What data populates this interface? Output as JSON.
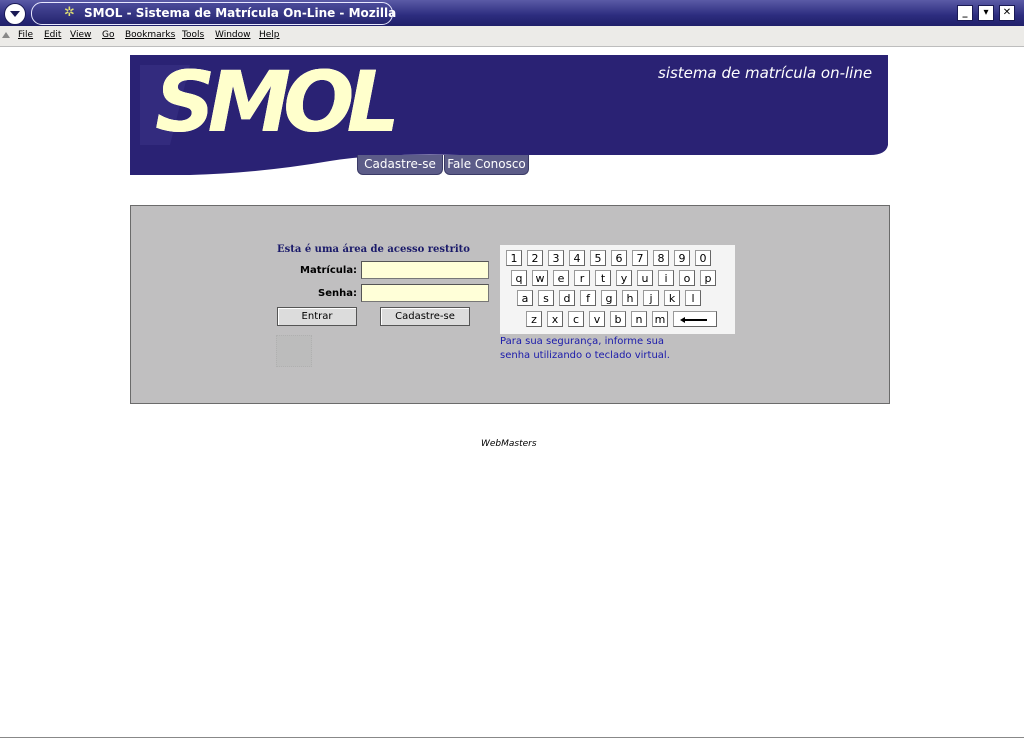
{
  "window": {
    "title": "SMOL - Sistema de Matrícula On-Line - Mozilla",
    "controls": {
      "minimize": "_",
      "maximize": "▾",
      "close": "✕"
    }
  },
  "menubar": {
    "items": [
      "File",
      "Edit",
      "View",
      "Go",
      "Bookmarks",
      "Tools",
      "Window",
      "Help"
    ]
  },
  "banner": {
    "logo": "SMOL",
    "tagline": "sistema de matrícula on-line",
    "tabs": [
      "Cadastre-se",
      "Fale Conosco"
    ],
    "colors": {
      "background": "#2a2274",
      "logo": "#ffffcc"
    }
  },
  "login": {
    "heading": "Esta é uma área de acesso restrito",
    "matricula_label": "Matrícula:",
    "matricula_value": "",
    "senha_label": "Senha:",
    "senha_value": "",
    "enter_button": "Entrar",
    "register_button": "Cadastre-se"
  },
  "keyboard": {
    "rows": [
      [
        "1",
        "2",
        "3",
        "4",
        "5",
        "6",
        "7",
        "8",
        "9",
        "0"
      ],
      [
        "q",
        "w",
        "e",
        "r",
        "t",
        "y",
        "u",
        "i",
        "o",
        "p"
      ],
      [
        "a",
        "s",
        "d",
        "f",
        "g",
        "h",
        "j",
        "k",
        "l"
      ],
      [
        "z",
        "x",
        "c",
        "v",
        "b",
        "n",
        "m"
      ]
    ],
    "backspace_icon": "backspace-arrow-icon",
    "note_line1": "Para sua segurança, informe sua",
    "note_line2": "senha utilizando o teclado virtual."
  },
  "footer": {
    "text": "WebMasters"
  }
}
